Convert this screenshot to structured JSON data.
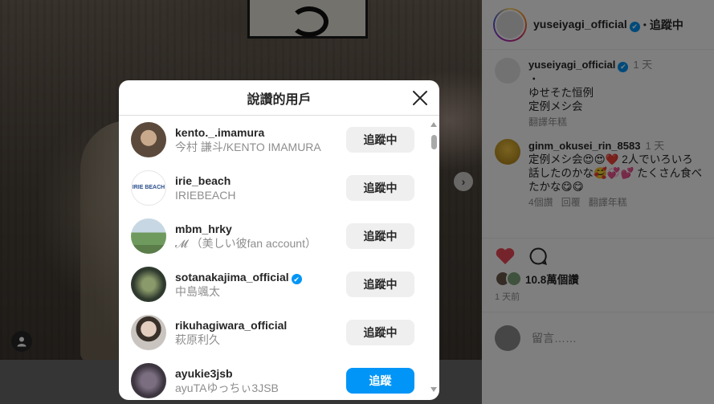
{
  "post": {
    "author": "yuseiyagi_official",
    "follow_state": "追蹤中",
    "separator": "•",
    "caption_time": "1 天",
    "caption_bullet": "・",
    "caption_line1": "ゆせそた恒例",
    "caption_line2": "定例メシ会",
    "see_translation": "翻譯年糕",
    "comment": {
      "username": "ginm_okusei_rin_8583",
      "time": "1 天",
      "text": "定例メシ会😍😍❤️ 2人でいろいろ話したのかな🥰💞💕 たくさん食べたかな😋😋",
      "likes": "4個讚",
      "reply": "回覆",
      "translate": "翻譯年糕"
    },
    "likes_count": "10.8萬個讚",
    "posted_ago": "1 天前",
    "comment_placeholder": "留言……"
  },
  "modal": {
    "title": "說讚的用戶",
    "users": [
      {
        "username": "kento._.imamura",
        "fullname": "今村 謙斗/KENTO IMAMURA",
        "button": "追蹤中",
        "following": true,
        "verified": false,
        "avatar_color": "#5b4a3c"
      },
      {
        "username": "irie_beach",
        "fullname": "IRIEBEACH",
        "button": "追蹤中",
        "following": true,
        "verified": false,
        "avatar_color": "#ffffff",
        "avatar_text": "IRIE BEACH"
      },
      {
        "username": "mbm_hrky",
        "fullname": "𝓜 （美しい彼fan account）",
        "button": "追蹤中",
        "following": true,
        "verified": false,
        "avatar_color": "#7fa57a"
      },
      {
        "username": "sotanakajima_official",
        "fullname": "中島颯太",
        "button": "追蹤中",
        "following": true,
        "verified": true,
        "avatar_color": "#2f3a2e"
      },
      {
        "username": "rikuhagiwara_official",
        "fullname": "萩原利久",
        "button": "追蹤中",
        "following": true,
        "verified": false,
        "avatar_color": "#c9c4bf"
      },
      {
        "username": "ayukie3jsb",
        "fullname": "ayuTAゆっちぃ3JSB",
        "button": "追蹤",
        "following": false,
        "verified": false,
        "avatar_color": "#3d3640"
      }
    ]
  },
  "icons": {
    "verified": "✔",
    "next": "›"
  },
  "colors": {
    "accent": "#0095f6",
    "like_heart": "#ed4956"
  }
}
